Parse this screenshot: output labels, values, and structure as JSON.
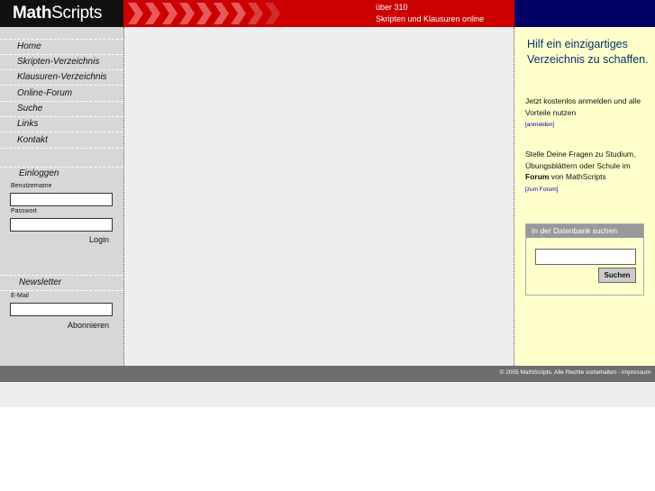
{
  "header": {
    "logo_bold": "Math",
    "logo_light": "Scripts",
    "tagline_line1": "über 310",
    "tagline_line2": "Skripten und Klausuren online"
  },
  "nav": {
    "items": [
      {
        "label": "Home"
      },
      {
        "label": "Skripten-Verzeichnis"
      },
      {
        "label": "Klausuren-Verzeichnis"
      },
      {
        "label": "Online-Forum"
      },
      {
        "label": "Suche"
      },
      {
        "label": "Links"
      },
      {
        "label": "Kontakt"
      }
    ]
  },
  "login": {
    "title": "Einloggen",
    "username_label": "Benutzername",
    "username_value": "",
    "password_label": "Passwort",
    "password_value": "",
    "button": "Login"
  },
  "newsletter": {
    "title": "Newsletter",
    "email_label": "E-Mail",
    "email_value": "",
    "button": "Abonnieren"
  },
  "promo": {
    "heading": "Hilf ein einzigartiges Verzeichnis zu schaffen.",
    "text1": "Jetzt kostenlos anmelden und alle Vorteile nutzen",
    "link1": "[anmelden]",
    "text2_a": "Stelle Deine Fragen zu Studium, Übungsblättern oder Schule im ",
    "text2_bold": "Forum",
    "text2_b": " von MathScripts",
    "link2": "[zum Forum]"
  },
  "db_search": {
    "title": "In der Datenbank suchen",
    "input_value": "",
    "button": "Suchen"
  },
  "footer": {
    "copyright": "© 2005 MathScripts. Alle Rechte vorbehalten - Impressum"
  },
  "colors": {
    "header_red": "#cc0000",
    "header_navy": "#000066",
    "sidebar_grey": "#d7d7d7",
    "promo_yellow": "#ffffcc",
    "footer_grey": "#6e6e6e"
  }
}
